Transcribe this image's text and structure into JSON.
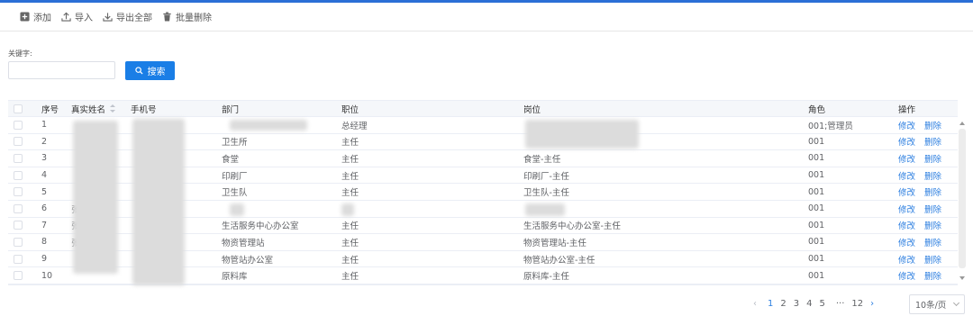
{
  "toolbar": {
    "add_label": "添加",
    "import_label": "导入",
    "export_label": "导出全部",
    "batch_delete_label": "批量删除"
  },
  "search": {
    "keyword_label": "关键字:",
    "keyword_value": "",
    "button_label": "搜索"
  },
  "table": {
    "headers": {
      "index": "序号",
      "name": "真实姓名",
      "phone": "手机号",
      "dept": "部门",
      "title": "职位",
      "post": "岗位",
      "role": "角色",
      "actions": "操作"
    },
    "rows": [
      {
        "index": "1",
        "name": "",
        "phone": "",
        "dept": "",
        "title": "总经理",
        "post": "",
        "role": "001;管理员",
        "edit": "修改",
        "delete": "删除"
      },
      {
        "index": "2",
        "name": "",
        "phone": "",
        "dept": "卫生所",
        "title": "主任",
        "post": "",
        "role": "001",
        "edit": "修改",
        "delete": "删除"
      },
      {
        "index": "3",
        "name": "",
        "phone": "",
        "dept": "食堂",
        "title": "主任",
        "post": "食堂-主任",
        "role": "001",
        "edit": "修改",
        "delete": "删除"
      },
      {
        "index": "4",
        "name": "",
        "phone": "",
        "dept": "印刷厂",
        "title": "主任",
        "post": "印刷厂-主任",
        "role": "001",
        "edit": "修改",
        "delete": "删除"
      },
      {
        "index": "5",
        "name": "",
        "phone": "",
        "dept": "卫生队",
        "title": "主任",
        "post": "卫生队-主任",
        "role": "001",
        "edit": "修改",
        "delete": "删除"
      },
      {
        "index": "6",
        "name": "张",
        "phone": "",
        "dept": "",
        "title": "",
        "post": "",
        "role": "001",
        "edit": "修改",
        "delete": "删除"
      },
      {
        "index": "7",
        "name": "张",
        "phone": "",
        "dept": "生活服务中心办公室",
        "title": "主任",
        "post": "生活服务中心办公室-主任",
        "role": "001",
        "edit": "修改",
        "delete": "删除"
      },
      {
        "index": "8",
        "name": "张",
        "phone": "",
        "dept": "物资管理站",
        "title": "主任",
        "post": "物资管理站-主任",
        "role": "001",
        "edit": "修改",
        "delete": "删除"
      },
      {
        "index": "9",
        "name": "",
        "phone": "",
        "dept": "物管站办公室",
        "title": "主任",
        "post": "物管站办公室-主任",
        "role": "001",
        "edit": "修改",
        "delete": "删除"
      },
      {
        "index": "10",
        "name": "",
        "phone": "",
        "dept": "原料库",
        "title": "主任",
        "post": "原料库-主任",
        "role": "001",
        "edit": "修改",
        "delete": "删除"
      }
    ]
  },
  "pagination": {
    "prev": "‹",
    "pages": [
      "1",
      "2",
      "3",
      "4",
      "5"
    ],
    "ellipsis": "···",
    "last_page": "12",
    "next": "›",
    "page_size": "10条/页",
    "current_page": "1"
  },
  "colors": {
    "accent": "#1a7ee6",
    "link": "#2d7fe0"
  }
}
